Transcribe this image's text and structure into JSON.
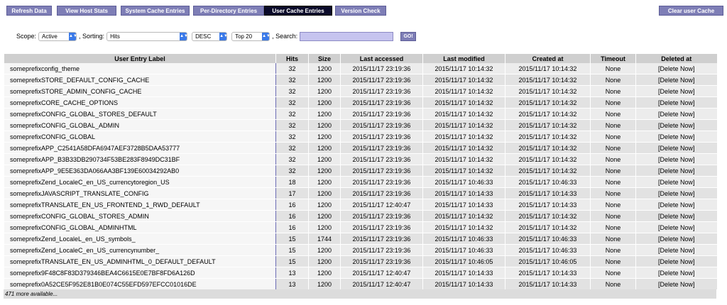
{
  "nav": {
    "refresh": "Refresh Data",
    "host_stats": "View Host Stats",
    "system_cache": "System Cache Entries",
    "per_dir": "Per-Directory Entries",
    "user_cache": "User Cache Entries",
    "version": "Version Check",
    "clear_cache": "Clear user Cache"
  },
  "filters": {
    "scope_label": "Scope:",
    "scope_value": "Active",
    "sorting_label": ", Sorting:",
    "sort_value": "Hits",
    "order_value": "DESC",
    "limit_value": "Top 20",
    "search_label": ", Search:",
    "search_value": "",
    "go_label": "GO!"
  },
  "table": {
    "columns": [
      "User Entry Label",
      "Hits",
      "Size",
      "Last accessed",
      "Last modified",
      "Created at",
      "Timeout",
      "Deleted at"
    ],
    "rows": [
      [
        "someprefixconfig_theme",
        "32",
        "1200",
        "2015/11/17 23:19:36",
        "2015/11/17 10:14:32",
        "2015/11/17 10:14:32",
        "None",
        "[Delete Now]"
      ],
      [
        "someprefixSTORE_DEFAULT_CONFIG_CACHE",
        "32",
        "1200",
        "2015/11/17 23:19:36",
        "2015/11/17 10:14:32",
        "2015/11/17 10:14:32",
        "None",
        "[Delete Now]"
      ],
      [
        "someprefixSTORE_ADMIN_CONFIG_CACHE",
        "32",
        "1200",
        "2015/11/17 23:19:36",
        "2015/11/17 10:14:32",
        "2015/11/17 10:14:32",
        "None",
        "[Delete Now]"
      ],
      [
        "someprefixCORE_CACHE_OPTIONS",
        "32",
        "1200",
        "2015/11/17 23:19:36",
        "2015/11/17 10:14:32",
        "2015/11/17 10:14:32",
        "None",
        "[Delete Now]"
      ],
      [
        "someprefixCONFIG_GLOBAL_STORES_DEFAULT",
        "32",
        "1200",
        "2015/11/17 23:19:36",
        "2015/11/17 10:14:32",
        "2015/11/17 10:14:32",
        "None",
        "[Delete Now]"
      ],
      [
        "someprefixCONFIG_GLOBAL_ADMIN",
        "32",
        "1200",
        "2015/11/17 23:19:36",
        "2015/11/17 10:14:32",
        "2015/11/17 10:14:32",
        "None",
        "[Delete Now]"
      ],
      [
        "someprefixCONFIG_GLOBAL",
        "32",
        "1200",
        "2015/11/17 23:19:36",
        "2015/11/17 10:14:32",
        "2015/11/17 10:14:32",
        "None",
        "[Delete Now]"
      ],
      [
        "someprefixAPP_C2541A58DFA6947AEF3728B5DAA53777",
        "32",
        "1200",
        "2015/11/17 23:19:36",
        "2015/11/17 10:14:32",
        "2015/11/17 10:14:32",
        "None",
        "[Delete Now]"
      ],
      [
        "someprefixAPP_B3B33DB290734F53BE283F8949DC31BF",
        "32",
        "1200",
        "2015/11/17 23:19:36",
        "2015/11/17 10:14:32",
        "2015/11/17 10:14:32",
        "None",
        "[Delete Now]"
      ],
      [
        "someprefixAPP_9E5E363DA066AA3BF139E60034292AB0",
        "32",
        "1200",
        "2015/11/17 23:19:36",
        "2015/11/17 10:14:32",
        "2015/11/17 10:14:32",
        "None",
        "[Delete Now]"
      ],
      [
        "someprefixZend_LocaleC_en_US_currencytoregion_US",
        "18",
        "1200",
        "2015/11/17 23:19:36",
        "2015/11/17 10:46:33",
        "2015/11/17 10:46:33",
        "None",
        "[Delete Now]"
      ],
      [
        "someprefixJAVASCRIPT_TRANSLATE_CONFIG",
        "17",
        "1200",
        "2015/11/17 23:19:36",
        "2015/11/17 10:14:33",
        "2015/11/17 10:14:33",
        "None",
        "[Delete Now]"
      ],
      [
        "someprefixTRANSLATE_EN_US_FRONTEND_1_RWD_DEFAULT",
        "16",
        "1200",
        "2015/11/17 12:40:47",
        "2015/11/17 10:14:33",
        "2015/11/17 10:14:33",
        "None",
        "[Delete Now]"
      ],
      [
        "someprefixCONFIG_GLOBAL_STORES_ADMIN",
        "16",
        "1200",
        "2015/11/17 23:19:36",
        "2015/11/17 10:14:32",
        "2015/11/17 10:14:32",
        "None",
        "[Delete Now]"
      ],
      [
        "someprefixCONFIG_GLOBAL_ADMINHTML",
        "16",
        "1200",
        "2015/11/17 23:19:36",
        "2015/11/17 10:14:32",
        "2015/11/17 10:14:32",
        "None",
        "[Delete Now]"
      ],
      [
        "someprefixZend_LocaleL_en_US_symbols_",
        "15",
        "1744",
        "2015/11/17 23:19:36",
        "2015/11/17 10:46:33",
        "2015/11/17 10:46:33",
        "None",
        "[Delete Now]"
      ],
      [
        "someprefixZend_LocaleC_en_US_currencynumber_",
        "15",
        "1200",
        "2015/11/17 23:19:36",
        "2015/11/17 10:46:33",
        "2015/11/17 10:46:33",
        "None",
        "[Delete Now]"
      ],
      [
        "someprefixTRANSLATE_EN_US_ADMINHTML_0_DEFAULT_DEFAULT",
        "15",
        "1200",
        "2015/11/17 23:19:36",
        "2015/11/17 10:46:05",
        "2015/11/17 10:46:05",
        "None",
        "[Delete Now]"
      ],
      [
        "someprefix9F48C8F83D379346BEA4C6615E0E7BF8FD6A126D",
        "13",
        "1200",
        "2015/11/17 12:40:47",
        "2015/11/17 10:14:33",
        "2015/11/17 10:14:33",
        "None",
        "[Delete Now]"
      ],
      [
        "someprefix0A52CE5F952E81B0E074C55EFD597EFCC01016DE",
        "13",
        "1200",
        "2015/11/17 12:40:47",
        "2015/11/17 10:14:33",
        "2015/11/17 10:14:33",
        "None",
        "[Delete Now]"
      ]
    ],
    "more_text": "471 more available..."
  }
}
